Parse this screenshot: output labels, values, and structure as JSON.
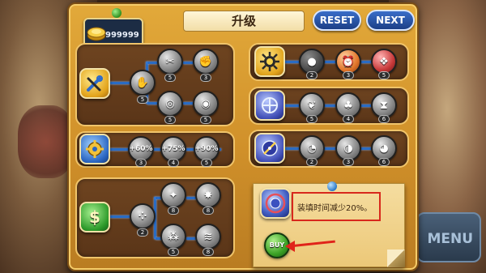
{
  "header": {
    "title": "升级",
    "coins": "999999",
    "reset_label": "RESET",
    "next_label": "NEXT"
  },
  "side_menu_label": "MENU",
  "trees": {
    "tools": {
      "category_icon": "wrench-screwdriver-icon",
      "nodes": [
        {
          "icon": "hand-tool-icon",
          "level": "5"
        },
        {
          "icon": "pliers-icon",
          "level": "5"
        },
        {
          "icon": "arm-icon",
          "level": "3"
        },
        {
          "icon": "wheel-icon",
          "level": "5"
        },
        {
          "icon": "spiral-icon",
          "level": "5"
        }
      ]
    },
    "speed": {
      "category_icon": "gold-gear-icon",
      "nodes": [
        {
          "label": "+60%",
          "level": "3"
        },
        {
          "label": "+75%",
          "level": "4"
        },
        {
          "label": "+90%",
          "level": "5"
        }
      ]
    },
    "money": {
      "category_icon": "dollar-icon",
      "nodes": [
        {
          "icon": "coins-icon",
          "level": "2"
        },
        {
          "icon": "sparkle-icon",
          "level": "8"
        },
        {
          "icon": "burst-icon",
          "level": "8"
        },
        {
          "icon": "pile-icon",
          "level": "5"
        },
        {
          "icon": "stack-icon",
          "level": "8"
        }
      ]
    },
    "gear": {
      "category_icon": "sun-gear-icon",
      "nodes": [
        {
          "icon": "orb-icon",
          "level": "2"
        },
        {
          "icon": "alarm-icon",
          "level": "3"
        },
        {
          "icon": "cash-icon",
          "level": "5"
        }
      ]
    },
    "shield": {
      "category_icon": "crosshair-icon",
      "nodes": [
        {
          "icon": "leaf-icon",
          "level": "5"
        },
        {
          "icon": "tree-icon",
          "level": "4"
        },
        {
          "icon": "funnel-icon",
          "level": "6"
        }
      ]
    },
    "compass": {
      "category_icon": "compass-icon",
      "nodes": [
        {
          "icon": "stopwatch-icon",
          "level": "2"
        },
        {
          "icon": "gauge-icon",
          "level": "3"
        },
        {
          "icon": "timer-icon",
          "level": "6"
        }
      ]
    }
  },
  "info": {
    "description": "装填时间减少20%。",
    "buy_label": "BUY"
  },
  "colors": {
    "board": "#d0902a",
    "panel": "#5a3518",
    "connector": "#2a6cc4",
    "highlight": "#d8281c"
  }
}
